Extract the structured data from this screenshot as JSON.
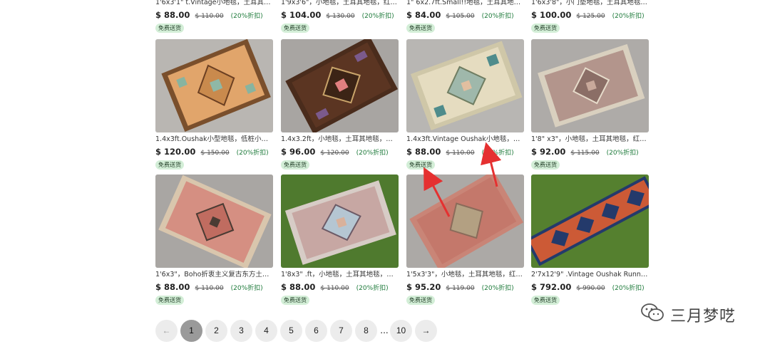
{
  "top_row": [
    {
      "title": "1'6x3'1\" t.Vintage小地毯，土耳其地毯，...",
      "price": "$ 88.00",
      "original": "$ 110.00",
      "discount": "(20%折扣)",
      "badge": "免费送货"
    },
    {
      "title": "1'9x3'6\"，小地毯，土耳其地毯，红色...",
      "price": "$ 104.00",
      "original": "$ 130.00",
      "discount": "(20%折扣)",
      "badge": "免费送货"
    },
    {
      "title": "1\" 6x2.7ft.Small!!地毯，土耳其地毯，红...",
      "price": "$ 84.00",
      "original": "$ 105.00",
      "discount": "(20%折扣)",
      "badge": "免费送货"
    },
    {
      "title": "1'6x3'8\"，小门垫地毯，土耳其地毯，O...",
      "price": "$ 100.00",
      "original": "$ 125.00",
      "discount": "(20%折扣)",
      "badge": "免费送货"
    }
  ],
  "row2": [
    {
      "title": "1.4x3ft.Oushak小型地毯，低桩小地毯...",
      "price": "$ 120.00",
      "original": "$ 150.00",
      "discount": "(20%折扣)",
      "badge": "免费送货",
      "rug": "tan"
    },
    {
      "title": "1.4x3.2ft，小地毯，土耳其地毯，红色...",
      "price": "$ 96.00",
      "original": "$ 120.00",
      "discount": "(20%折扣)",
      "badge": "免费送货",
      "rug": "brown"
    },
    {
      "title": "1.4x3ft.Vintage Oushak小地毯，小粉...",
      "price": "$ 88.00",
      "original": "$ 110.00",
      "discount": "(20%折扣)",
      "badge": "免费送货",
      "rug": "pale"
    },
    {
      "title": "1'8\" x3\"，小地毯，土耳其地毯，红色...",
      "price": "$ 92.00",
      "original": "$ 115.00",
      "discount": "(20%折扣)",
      "badge": "免费送货",
      "rug": "mauve"
    }
  ],
  "row3": [
    {
      "title": "1'6x3\"，Boho折衷主义复古东方土耳其...",
      "price": "$ 88.00",
      "original": "$ 110.00",
      "discount": "(20%折扣)",
      "badge": "免费送货",
      "rug": "pink"
    },
    {
      "title": "1'8x3\" .ft，小地毯，土耳其地毯，红色...",
      "price": "$ 88.00",
      "original": "$ 110.00",
      "discount": "(20%折扣)",
      "badge": "免费送货",
      "rug": "grass"
    },
    {
      "title": "1'5x3'3\"，小地毯，土耳其地毯，红色...",
      "price": "$ 95.20",
      "original": "$ 119.00",
      "discount": "(20%折扣)",
      "badge": "免费送货",
      "rug": "faded"
    },
    {
      "title": "2'7x12'9\" .Vintage Oushak Runner，...",
      "price": "$ 792.00",
      "original": "$ 990.00",
      "discount": "(20%折扣)",
      "badge": "免费送货",
      "rug": "runner"
    }
  ],
  "pagination": {
    "prev": "←",
    "pages": [
      "1",
      "2",
      "3",
      "4",
      "5",
      "6",
      "7",
      "8"
    ],
    "ellipsis": "...",
    "last": "10",
    "next": "→",
    "current": "1"
  },
  "watermark": {
    "text": "三月梦呓",
    "icon": "wechat-icon"
  },
  "colors": {
    "badge_bg": "#d3eed7",
    "discount": "#1d7a3a",
    "active_page": "#9a9a9a",
    "annotation_arrow": "#e53030"
  }
}
